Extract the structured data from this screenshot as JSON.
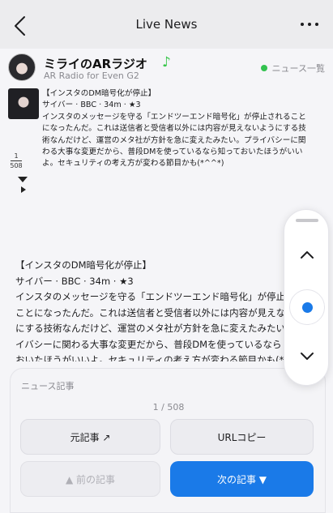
{
  "nav": {
    "title": "Live News",
    "back_icon": "chevron-left-icon",
    "more_icon": "more-horizontal-icon"
  },
  "app": {
    "name": "ミライのARラジオ",
    "note_icon": "♪",
    "subtitle": "AR Radio for Even G2",
    "status_label": "ニュース一覧",
    "status_color": "#33c24f"
  },
  "glasses_view": {
    "lines": [
      "【インスタのDM暗号化が停止】",
      "サイバー · BBC · 34m · ★3",
      "インスタのメッセージを守る「エンドツーエンド暗号化」が停止されること",
      "になったんだ。これは送信者と受信者以外には内容が見えないようにする技",
      "術なんだけど、運営のメタ社が方針を急に変えたみたい。プライバシーに関",
      "わる大事な変更だから、普段DMを使っているなら知っておいたほうがいい",
      "よ。セキュリティの考え方が変わる節目かも(*^^*)"
    ],
    "counter_current": "1",
    "counter_total": "508"
  },
  "reader": {
    "lines": [
      "【インスタのDM暗号化が停止】",
      "サイバー · BBC · 34m · ★3",
      "インスタのメッセージを守る「エンドツーエンド暗号化」が停止",
      "ことになったんだ。これは送信者と受信者以外には内容が見えな",
      "にする技術なんだけど、運営のメタ社が方針を急に変えたみたい",
      "イバシーに関わる大事な変更だから、普段DMを使っているなら",
      "おいたほうがいいよ。セキュリティの考え方が変わる節目かも(*"
    ]
  },
  "panel": {
    "title": "ニュース記事",
    "page_indicator": "1 / 508",
    "buttons": {
      "original": "元記事 ↗",
      "copy_url": "URLコピー",
      "prev": "▲ 前の記事",
      "next": "次の記事 ▼"
    },
    "accent_color": "#1a7ae8"
  },
  "scroller": {
    "up_icon": "chevron-up-icon",
    "down_icon": "chevron-down-icon",
    "center_icon": "dot-icon"
  }
}
